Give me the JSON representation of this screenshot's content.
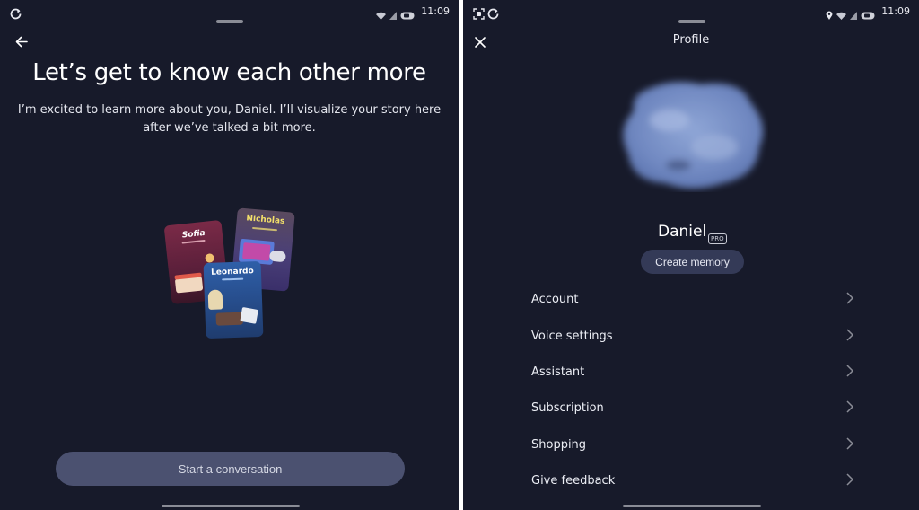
{
  "status_bar": {
    "time": "11:09"
  },
  "onboarding": {
    "title": "Let’s get to know each other more",
    "subtitle": "I’m excited to learn more about you, Daniel. I’ll visualize your story here after we’ve talked a bit more.",
    "cards": [
      "Sofia",
      "Nicholas",
      "Leonardo"
    ],
    "cta_label": "Start a conversation"
  },
  "profile": {
    "header_title": "Profile",
    "user_name": "Daniel",
    "badge": "PRO",
    "create_memory_label": "Create memory",
    "menu_items": [
      {
        "label": "Account"
      },
      {
        "label": "Voice settings"
      },
      {
        "label": "Assistant"
      },
      {
        "label": "Subscription"
      },
      {
        "label": "Shopping"
      },
      {
        "label": "Give feedback"
      }
    ]
  },
  "colors": {
    "background": "#171a2a",
    "cta_button": "#4b5170",
    "memory_button": "#343a57"
  }
}
